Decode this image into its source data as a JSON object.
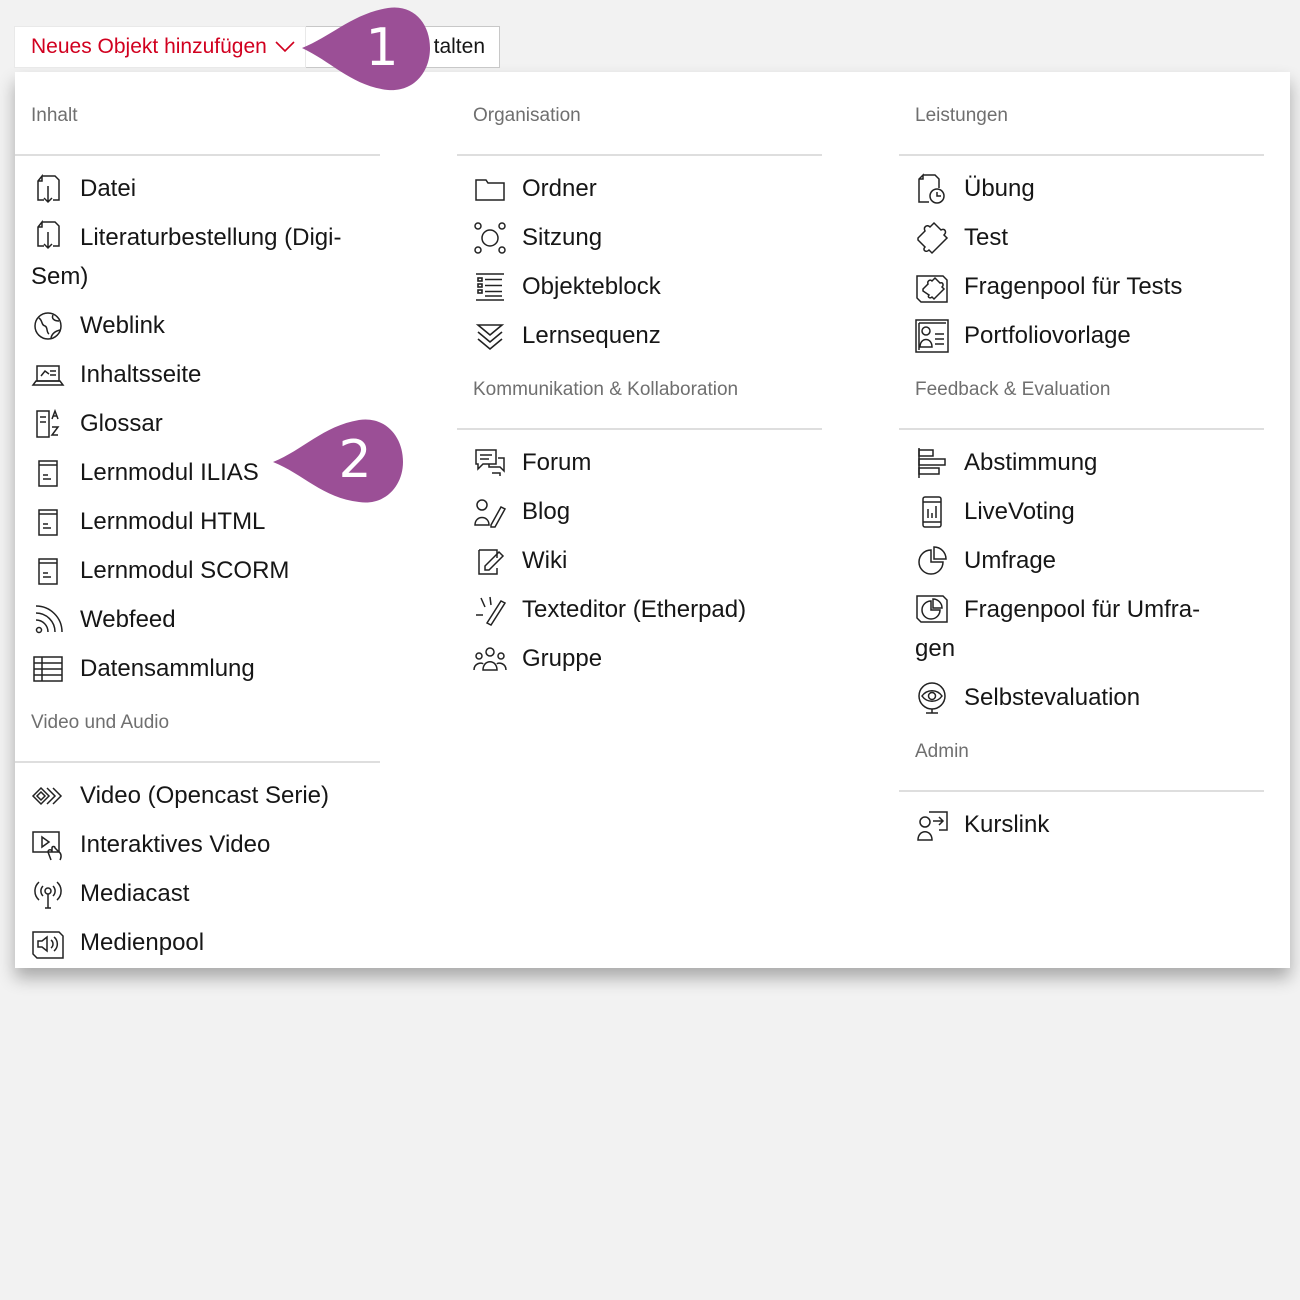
{
  "toolbar": {
    "add_label": "Neues Objekt hinzufügen",
    "design_label_partial": "talten"
  },
  "callouts": {
    "one": "1",
    "two": "2"
  },
  "accent": "#d1001f",
  "callout_color": "#9b4f96",
  "columns": {
    "inhalt": {
      "title": "Inhalt",
      "items": [
        {
          "label": "Datei",
          "icon": "file-download-icon"
        },
        {
          "label": "Literaturbestellung (Digi-Sem)",
          "icon": "file-download-icon"
        },
        {
          "label": "Weblink",
          "icon": "globe-icon"
        },
        {
          "label": "Inhaltsseite",
          "icon": "laptop-icon"
        },
        {
          "label": "Glossar",
          "icon": "glossary-az-icon"
        },
        {
          "label": "Lernmodul ILIAS",
          "icon": "document-icon"
        },
        {
          "label": "Lernmodul HTML",
          "icon": "document-icon"
        },
        {
          "label": "Lernmodul SCORM",
          "icon": "document-icon"
        },
        {
          "label": "Webfeed",
          "icon": "rss-icon"
        },
        {
          "label": "Datensammlung",
          "icon": "table-icon"
        }
      ],
      "sub_title": "Video und Audio",
      "sub_items": [
        {
          "label": "Video (Opencast Serie)",
          "icon": "opencast-icon"
        },
        {
          "label": "Interaktives Video",
          "icon": "interactive-video-icon"
        },
        {
          "label": "Mediacast",
          "icon": "broadcast-icon"
        },
        {
          "label": "Medienpool",
          "icon": "speaker-icon"
        }
      ]
    },
    "organisation": {
      "title": "Organisation",
      "items": [
        {
          "label": "Ordner",
          "icon": "folder-icon"
        },
        {
          "label": "Sitzung",
          "icon": "session-icon"
        },
        {
          "label": "Objekteblock",
          "icon": "list-block-icon"
        },
        {
          "label": "Lernsequenz",
          "icon": "chevrons-down-icon"
        }
      ],
      "sub_title": "Kommunikation & Kollaboration",
      "sub_items": [
        {
          "label": "Forum",
          "icon": "chat-icon"
        },
        {
          "label": "Blog",
          "icon": "blog-icon"
        },
        {
          "label": "Wiki",
          "icon": "wiki-edit-icon"
        },
        {
          "label": "Texteditor (Etherpad)",
          "icon": "pen-icon"
        },
        {
          "label": "Gruppe",
          "icon": "group-icon"
        }
      ]
    },
    "leistungen": {
      "title": "Leistungen",
      "items": [
        {
          "label": "Übung",
          "icon": "exercise-clock-icon"
        },
        {
          "label": "Test",
          "icon": "puzzle-icon"
        },
        {
          "label": "Fragenpool für Tests",
          "icon": "puzzle-pool-icon"
        },
        {
          "label": "Portfoliovorlage",
          "icon": "portfolio-icon"
        }
      ],
      "sub_title": "Feedback & Evaluation",
      "sub_items": [
        {
          "label": "Abstimmung",
          "icon": "bar-poll-icon"
        },
        {
          "label": "LiveVoting",
          "icon": "phone-chart-icon"
        },
        {
          "label": "Umfrage",
          "icon": "pie-survey-icon"
        },
        {
          "label": "Fragenpool für Umfra-gen",
          "icon": "pie-pool-icon"
        },
        {
          "label": "Selbstevaluation",
          "icon": "eye-monitor-icon"
        }
      ],
      "sub2_title": "Admin",
      "sub2_items": [
        {
          "label": "Kurslink",
          "icon": "course-link-icon"
        }
      ]
    }
  }
}
